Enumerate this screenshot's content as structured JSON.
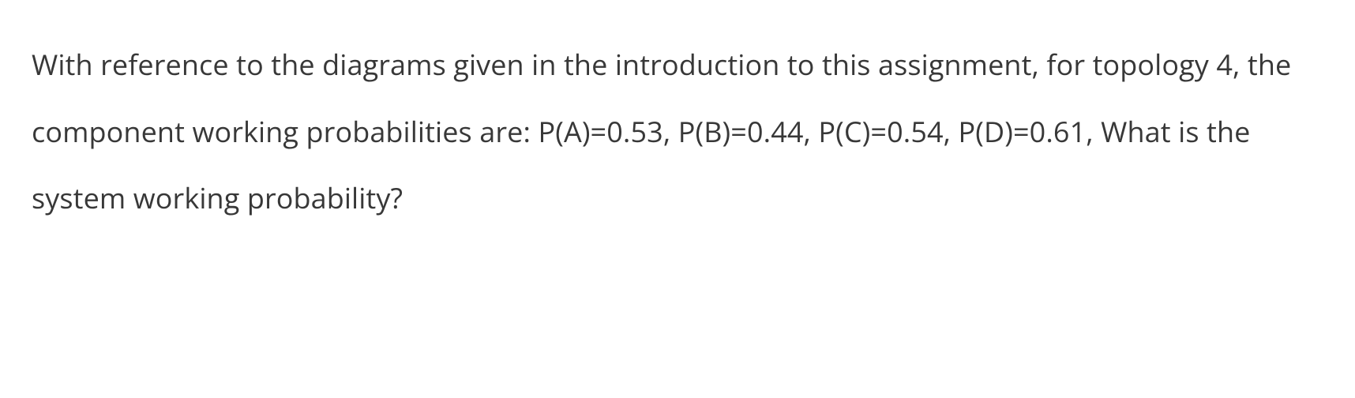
{
  "question": {
    "text": "With reference to the diagrams given in the introduction to this assignment, for topology 4, the component working probabilities are: P(A)=0.53, P(B)=0.44, P(C)=0.54, P(D)=0.61, What is the system working probability?",
    "topology": 4,
    "probabilities": {
      "P(A)": 0.53,
      "P(B)": 0.44,
      "P(C)": 0.54,
      "P(D)": 0.61
    }
  }
}
